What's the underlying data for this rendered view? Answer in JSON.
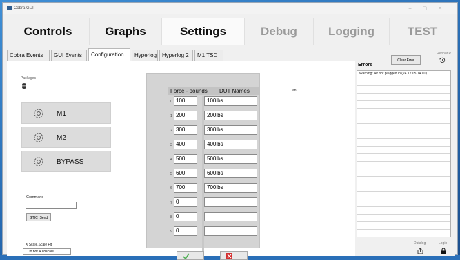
{
  "window": {
    "title": "Cobra GUI"
  },
  "main_tabs": [
    "Controls",
    "Graphs",
    "Settings",
    "Debug",
    "Logging",
    "TEST"
  ],
  "sub_tabs": [
    "Cobra Events",
    "GUI Events",
    "Configuration",
    "Hyperlog",
    "Hyperlog 2",
    "M1 TSD"
  ],
  "packages": {
    "label": "Packages",
    "items": [
      {
        "label": "M1",
        "icon": "gear-icon"
      },
      {
        "label": "M2",
        "icon": "gear-icon"
      },
      {
        "label": "BYPASS",
        "icon": "gear-icon"
      }
    ]
  },
  "command": {
    "label": "Command",
    "value": "",
    "send_label": "GTIC_Send"
  },
  "xscale": {
    "label": "X Scale.Scale Fit",
    "value": "Do not Autoscale"
  },
  "force_table": {
    "header_force": "Force - pounds",
    "header_names": "DUT Names",
    "rows": [
      {
        "index": "0",
        "force": "100",
        "name": "100lbs"
      },
      {
        "index": "1",
        "force": "200",
        "name": "200lbs"
      },
      {
        "index": "2",
        "force": "300",
        "name": "300lbs"
      },
      {
        "index": "3",
        "force": "400",
        "name": "400lbs"
      },
      {
        "index": "4",
        "force": "500",
        "name": "500lbs"
      },
      {
        "index": "5",
        "force": "600",
        "name": "600lbs"
      },
      {
        "index": "6",
        "force": "700",
        "name": "700lbs"
      },
      {
        "index": "7",
        "force": "0",
        "name": ""
      },
      {
        "index": "8",
        "force": "0",
        "name": ""
      },
      {
        "index": "9",
        "force": "0",
        "name": ""
      }
    ]
  },
  "side_label": "an",
  "errors": {
    "title": "Errors",
    "clear_label": "Clear Error",
    "reboot_label": "Reboot RT",
    "items": [
      "Warning: Air not plugged in  (24 12 05 14 01)"
    ]
  },
  "footer": {
    "datalog_label": "Datalog",
    "login_label": "Login"
  },
  "colors": {
    "desktop": "#2a6fb8",
    "button_bg": "#dcdcdc",
    "accent_green": "#4caf50",
    "accent_red": "#d32f2f"
  }
}
